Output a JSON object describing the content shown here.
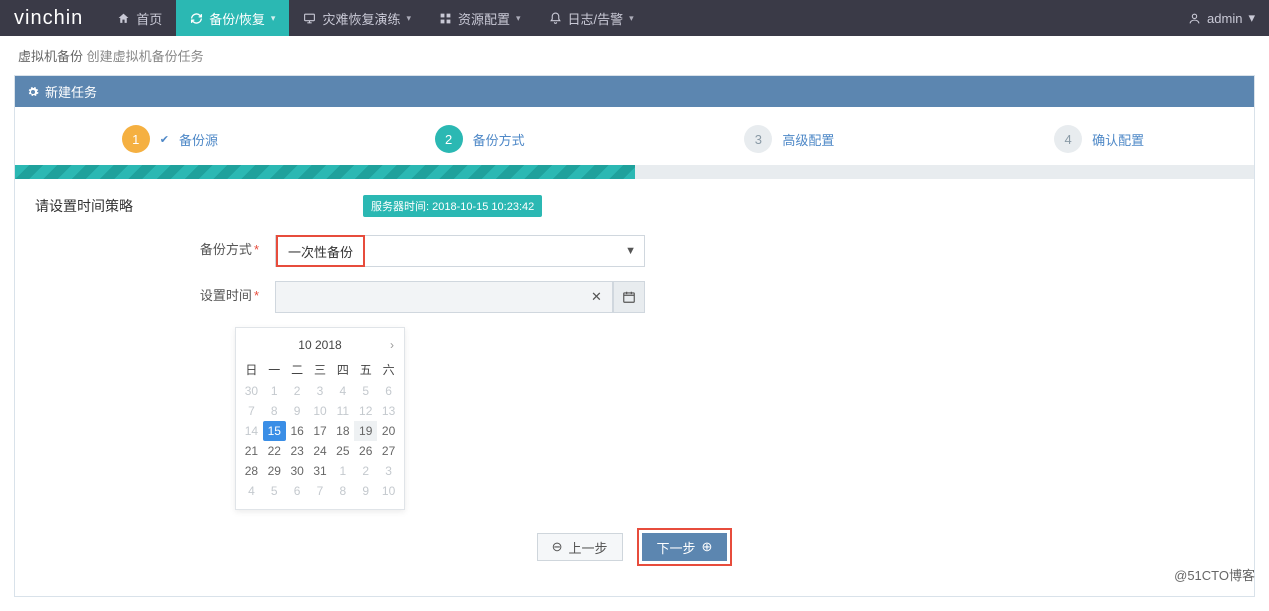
{
  "brand": "vinchin",
  "nav": {
    "home": "首页",
    "backup": "备份/恢复",
    "dr": "灾难恢复演练",
    "resource": "资源配置",
    "log": "日志/告警"
  },
  "user": {
    "name": "admin"
  },
  "breadcrumb": {
    "a": "虚拟机备份",
    "b": "创建虚拟机备份任务"
  },
  "panel_title": "新建任务",
  "steps": {
    "s1": "备份源",
    "s2": "备份方式",
    "s3": "高级配置",
    "s4": "确认配置"
  },
  "form": {
    "section_title": "请设置时间策略",
    "server_time_label": "服务器时间: 2018-10-15 10:23:42",
    "method_label": "备份方式",
    "method_value": "一次性备份",
    "time_label": "设置时间",
    "time_value": ""
  },
  "calendar": {
    "title": "10 2018",
    "dow": [
      "日",
      "一",
      "二",
      "三",
      "四",
      "五",
      "六"
    ],
    "weeks": [
      [
        {
          "n": 30,
          "m": true
        },
        {
          "n": 1,
          "m": true
        },
        {
          "n": 2,
          "m": true
        },
        {
          "n": 3,
          "m": true
        },
        {
          "n": 4,
          "m": true
        },
        {
          "n": 5,
          "m": true
        },
        {
          "n": 6,
          "m": true
        }
      ],
      [
        {
          "n": 7,
          "m": true
        },
        {
          "n": 8,
          "m": true
        },
        {
          "n": 9,
          "m": true
        },
        {
          "n": 10,
          "m": true
        },
        {
          "n": 11,
          "m": true
        },
        {
          "n": 12,
          "m": true
        },
        {
          "n": 13,
          "m": true
        }
      ],
      [
        {
          "n": 14,
          "m": true
        },
        {
          "n": 15,
          "sel": true
        },
        {
          "n": 16
        },
        {
          "n": 17
        },
        {
          "n": 18
        },
        {
          "n": 19,
          "hint": true
        },
        {
          "n": 20
        }
      ],
      [
        {
          "n": 21
        },
        {
          "n": 22
        },
        {
          "n": 23
        },
        {
          "n": 24
        },
        {
          "n": 25
        },
        {
          "n": 26
        },
        {
          "n": 27
        }
      ],
      [
        {
          "n": 28
        },
        {
          "n": 29
        },
        {
          "n": 30
        },
        {
          "n": 31
        },
        {
          "n": 1,
          "m": true
        },
        {
          "n": 2,
          "m": true
        },
        {
          "n": 3,
          "m": true
        }
      ],
      [
        {
          "n": 4,
          "m": true
        },
        {
          "n": 5,
          "m": true
        },
        {
          "n": 6,
          "m": true
        },
        {
          "n": 7,
          "m": true
        },
        {
          "n": 8,
          "m": true
        },
        {
          "n": 9,
          "m": true
        },
        {
          "n": 10,
          "m": true
        }
      ]
    ]
  },
  "buttons": {
    "prev": "上一步",
    "next": "下一步"
  },
  "watermark": "@51CTO博客"
}
